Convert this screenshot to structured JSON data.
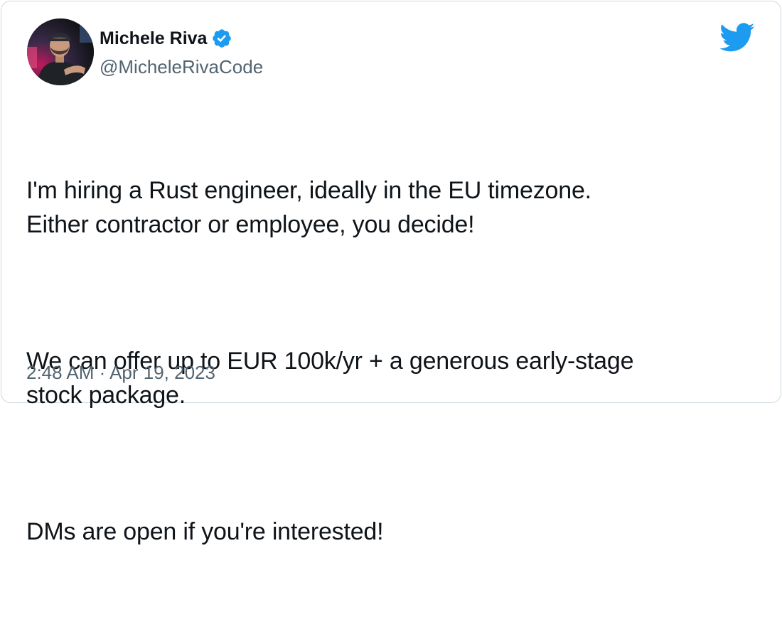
{
  "author": {
    "display_name": "Michele Riva",
    "handle": "@MicheleRivaCode",
    "verified": true,
    "avatar_icon": "avatar-photo"
  },
  "brand": {
    "icon": "twitter-bird-icon",
    "color": "#1d9bf0"
  },
  "tweet": {
    "paragraphs": [
      "I'm hiring a Rust engineer, ideally in the EU timezone.\nEither contractor or employee, you decide!",
      "We can offer up to EUR 100k/yr + a generous early-stage\nstock package.",
      "DMs are open if you're interested!"
    ]
  },
  "meta": {
    "timestamp": "2:48 AM · Apr 19, 2023"
  },
  "colors": {
    "text": "#0f1419",
    "secondary": "#536471",
    "border": "#cfd9de",
    "verified": "#1d9bf0"
  }
}
